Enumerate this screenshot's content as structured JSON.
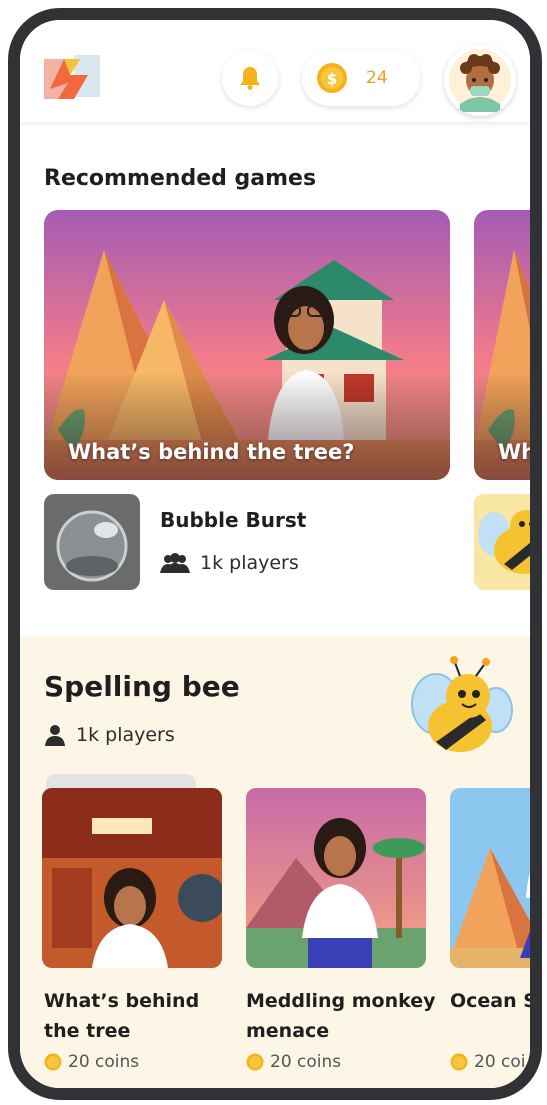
{
  "header": {
    "coin_count": "24"
  },
  "recommended": {
    "title": "Recommended games",
    "hero_cards": [
      {
        "caption": "What’s behind the tree?"
      },
      {
        "caption": "Wh"
      }
    ],
    "game": {
      "name": "Bubble Burst",
      "players": "1k players"
    }
  },
  "spelling_bee": {
    "title": "Spelling bee",
    "players": "1k players",
    "cards": [
      {
        "title": "What’s behind the tree",
        "coins": "20 coins"
      },
      {
        "title": "Meddling monkey menace",
        "coins": "20 coins"
      },
      {
        "title": "Ocean Sp",
        "coins": "20 coi"
      }
    ]
  },
  "colors": {
    "accent": "#E9A21C",
    "band_bg": "#fdf6e7",
    "frame": "#303235"
  },
  "icons": [
    "logo-icon",
    "bell-icon",
    "coin-icon",
    "avatar-icon",
    "group-icon",
    "person-icon",
    "bee-icon"
  ]
}
